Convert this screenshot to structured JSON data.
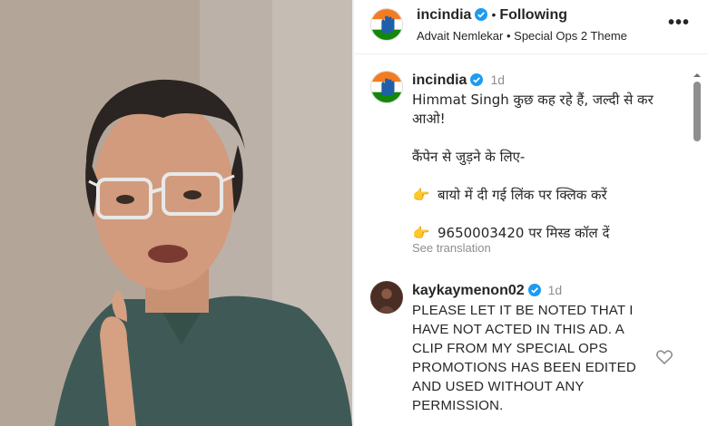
{
  "post": {
    "username": "incindia",
    "follow_status": "Following",
    "subtitle": "Advait Nemlekar • Special Ops 2 Theme",
    "more_label": "•••"
  },
  "caption": {
    "username": "incindia",
    "time": "1d",
    "lines": [
      "Himmat Singh कुछ कह रहे हैं, जल्दी से कर आओ!",
      "कैंपेन से जुड़ने के लिए-",
      "बायो में दी गई लिंक पर क्लिक करें",
      "9650003420 पर मिस्ड कॉल दें"
    ],
    "pointing_emoji": "👉",
    "see_translation": "See translation"
  },
  "comment": {
    "username": "kaykaymenon02",
    "time": "1d",
    "text": "PLEASE LET IT BE NOTED THAT I HAVE NOT ACTED IN THIS AD. A CLIP FROM MY SPECIAL OPS PROMOTIONS HAS BEEN EDITED AND USED WITHOUT ANY PERMISSION."
  },
  "icons": {
    "verified": "verified-badge-icon",
    "like": "heart-icon",
    "more": "more-options-icon",
    "logo": "congress-hand-logo-icon"
  },
  "colors": {
    "verified_blue": "#1d9bf0",
    "saffron": "#f47c20",
    "green": "#138808",
    "muted_text": "#8e8e8e"
  }
}
